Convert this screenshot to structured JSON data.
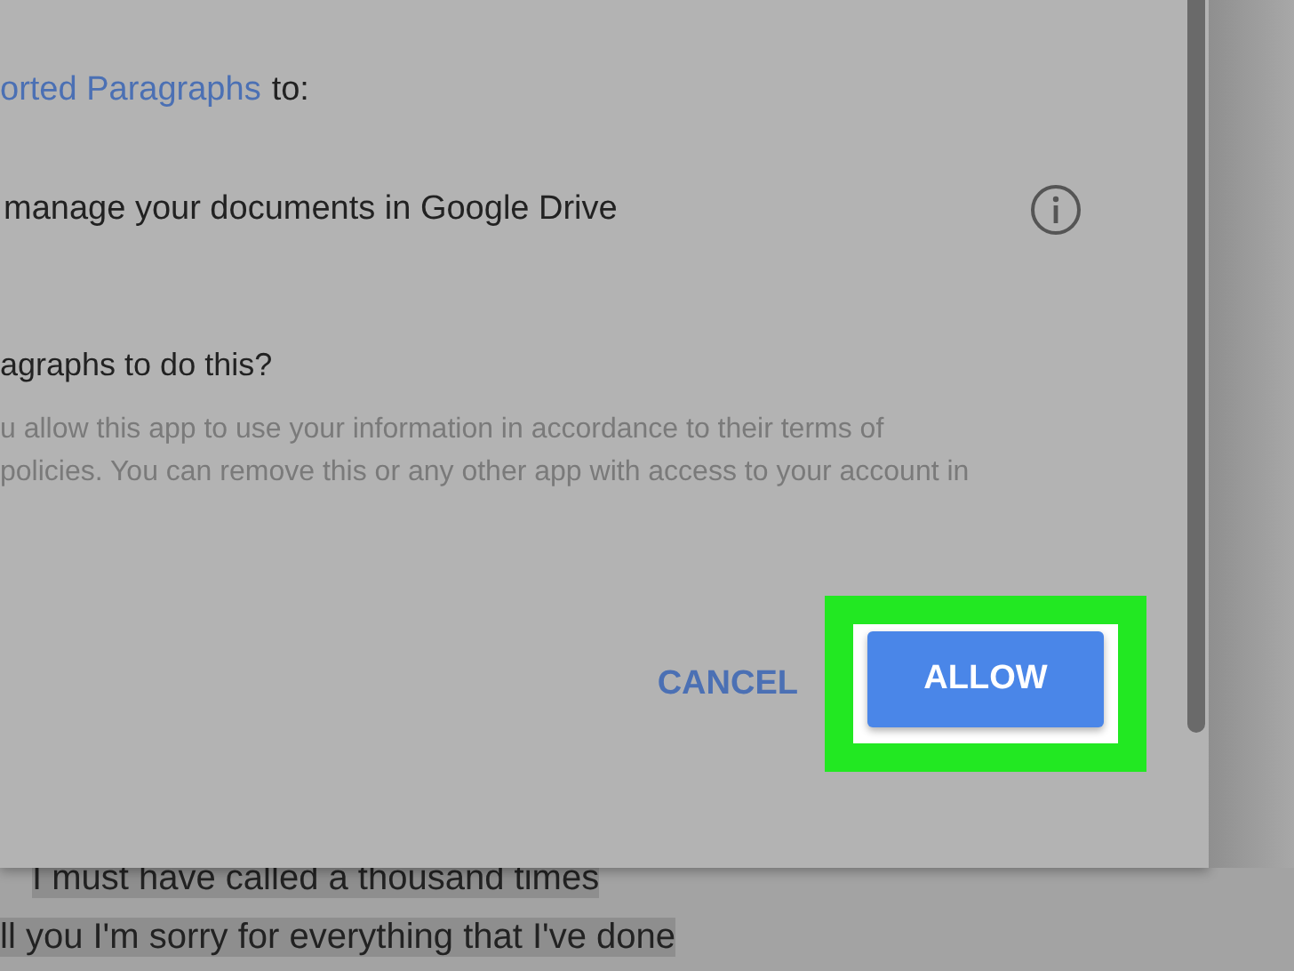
{
  "dialog": {
    "heading": {
      "app_name": "orted Paragraphs",
      "rest": "to:"
    },
    "permissions": [
      {
        "text": "manage your documents in Google Drive"
      }
    ],
    "question": "agraphs to do this?",
    "body_lines": [
      "u allow this app to use your information in accordance to their terms of",
      "policies. You can remove this or any other app with access to your account in"
    ],
    "buttons": [
      {
        "label": "CANCEL",
        "kind": "text",
        "highlighted": false
      },
      {
        "label": "ALLOW",
        "kind": "raised",
        "highlighted": true
      }
    ]
  },
  "document": {
    "lines": [
      {
        "text": "I must have called a thousand times",
        "selected": true
      },
      {
        "text": "ll you I'm sorry for everything that I've done",
        "selected": true
      }
    ]
  }
}
